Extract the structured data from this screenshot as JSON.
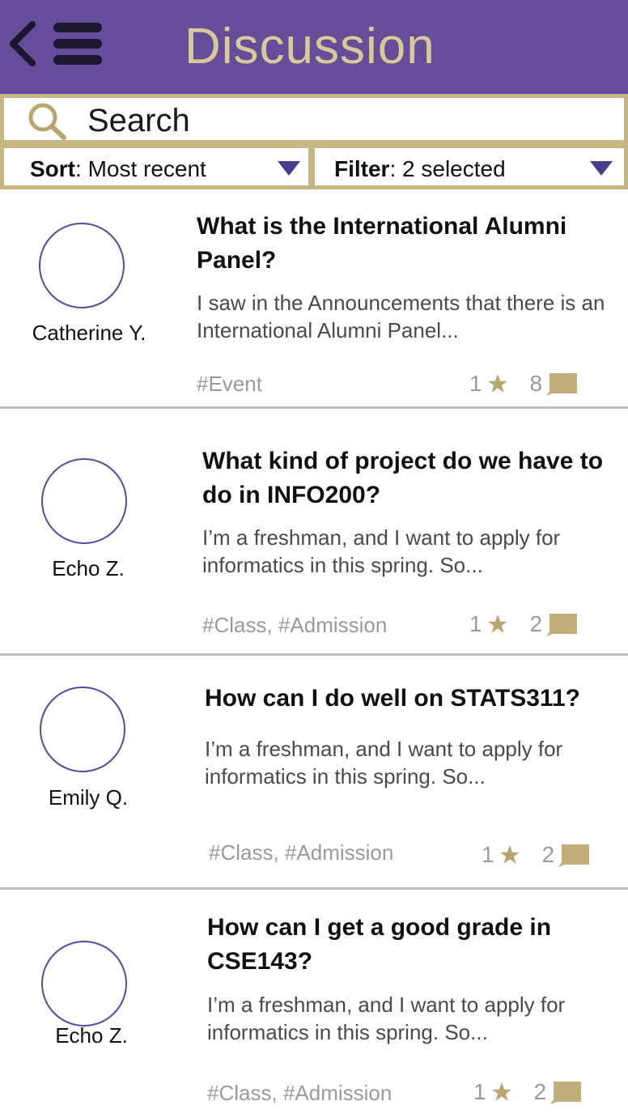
{
  "header": {
    "title": "Discussion",
    "back_icon": "chevron-left-icon",
    "menu_icon": "hamburger-menu-icon"
  },
  "search": {
    "placeholder": "Search",
    "icon": "search-icon"
  },
  "sort": {
    "label": "Sort",
    "value": "Most recent"
  },
  "filter": {
    "label": "Filter",
    "value": "2 selected"
  },
  "colors": {
    "header_bg": "#654d9a",
    "accent_gold": "#c7b683",
    "title_text": "#d9c89a",
    "avatar_ring": "#5a48a0"
  },
  "posts": [
    {
      "author": "Catherine Y.",
      "title": "What is the International Alumni Panel?",
      "excerpt": "I saw in the Announcements that there is an International Alumni Panel...",
      "tags": [
        "#Event"
      ],
      "stars": "1",
      "comments": "8"
    },
    {
      "author": "Echo Z.",
      "title": "What kind of project do we have to do in INFO200?",
      "excerpt": "I’m a freshman, and I want to apply for informatics in this spring. So...",
      "tags": [
        "#Class",
        "#Admission"
      ],
      "stars": "1",
      "comments": "2"
    },
    {
      "author": "Emily Q.",
      "title": "How can I do well on STATS311?",
      "excerpt": "I’m a freshman, and I want to apply for informatics in this spring. So...",
      "tags": [
        "#Class",
        "#Admission"
      ],
      "stars": "1",
      "comments": "2"
    },
    {
      "author": "Echo Z.",
      "title": "How can I get a good grade in CSE143?",
      "excerpt": "I’m a freshman, and I want to apply for informatics in this spring. So...",
      "tags": [
        "#Class",
        "#Admission"
      ],
      "stars": "1",
      "comments": "2"
    }
  ]
}
